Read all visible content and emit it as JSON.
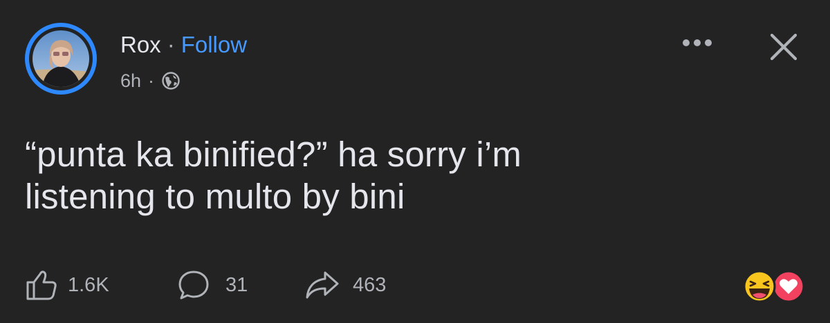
{
  "header": {
    "author_name": "Rox",
    "separator": "·",
    "follow_label": "Follow",
    "time": "6h",
    "meta_separator": "·",
    "privacy_icon": "globe-icon",
    "more_icon": "more-horizontal-icon",
    "close_icon": "close-icon"
  },
  "post": {
    "lines": [
      "“punta ka binified?” ha sorry i’m",
      "listening to multo by bini"
    ]
  },
  "actions": {
    "like": {
      "icon": "thumbs-up-icon",
      "count": "1.6K"
    },
    "comment": {
      "icon": "comment-bubble-icon",
      "count": "31"
    },
    "share": {
      "icon": "share-arrow-icon",
      "count": "463"
    }
  },
  "reactions": [
    "haha-emoji-icon",
    "love-heart-icon"
  ],
  "colors": {
    "background": "#232324",
    "primary_text": "#e4e6eb",
    "secondary_text": "#b0b3b8",
    "link": "#4599ff",
    "story_ring": "#2e89ff",
    "love_red": "#f3425f",
    "haha_yellow": "#f7c51e"
  }
}
